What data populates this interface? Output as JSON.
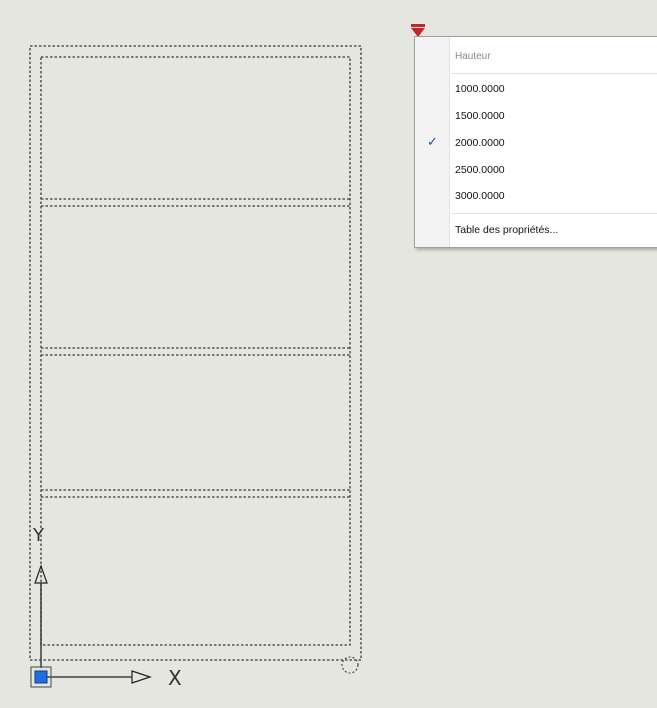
{
  "axes": {
    "y_label": "Y",
    "x_label": "X"
  },
  "menu": {
    "header": "Hauteur",
    "items": [
      {
        "label": "1000.0000",
        "checked": false
      },
      {
        "label": "1500.0000",
        "checked": false
      },
      {
        "label": "2000.0000",
        "checked": true
      },
      {
        "label": "2500.0000",
        "checked": false
      },
      {
        "label": "3000.0000",
        "checked": false
      }
    ],
    "footer": "Table des propriétés...",
    "check_glyph": "✓"
  },
  "colors": {
    "background": "#e5e6e0",
    "grip": "#c0262a",
    "ucs_origin": "#1f6fe0",
    "check": "#1c4fa5"
  }
}
